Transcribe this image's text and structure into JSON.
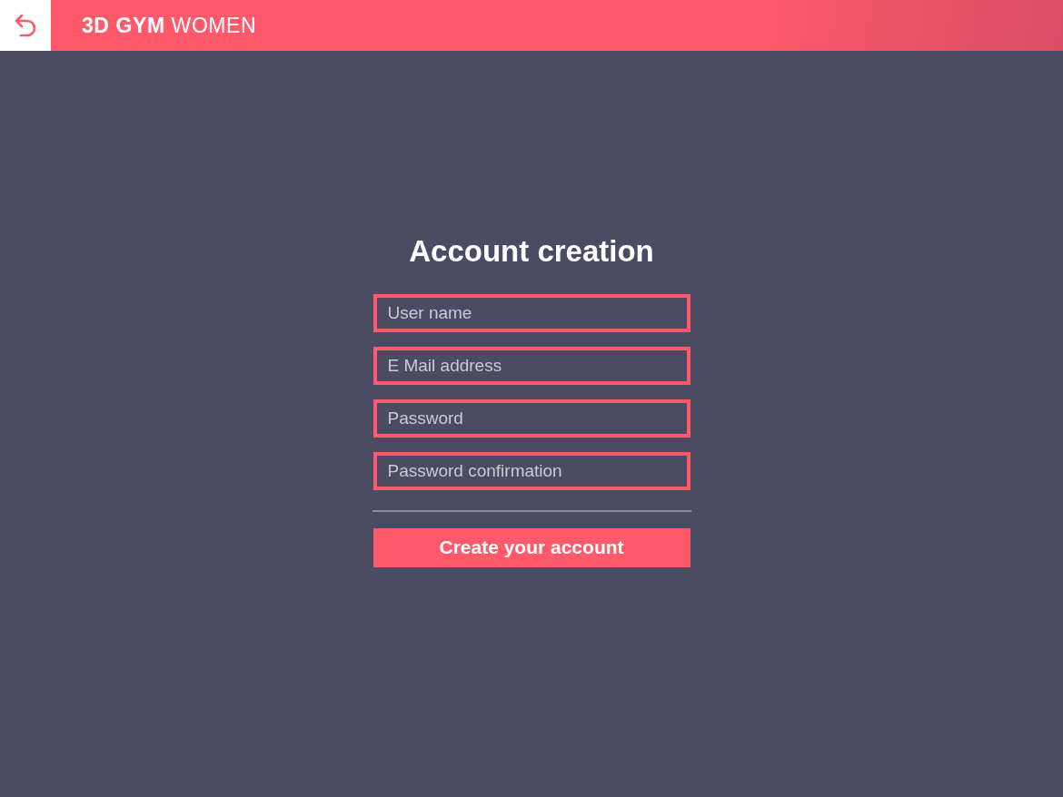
{
  "header": {
    "logo": "**3D GYM** WOMEN"
  },
  "form": {
    "title": "Account creation",
    "fields": [
      {
        "placeholder": "User name"
      },
      {
        "placeholder": "E Mail address"
      },
      {
        "placeholder": "Password"
      },
      {
        "placeholder": "Password confirmation"
      }
    ],
    "submit": "Create your account"
  }
}
